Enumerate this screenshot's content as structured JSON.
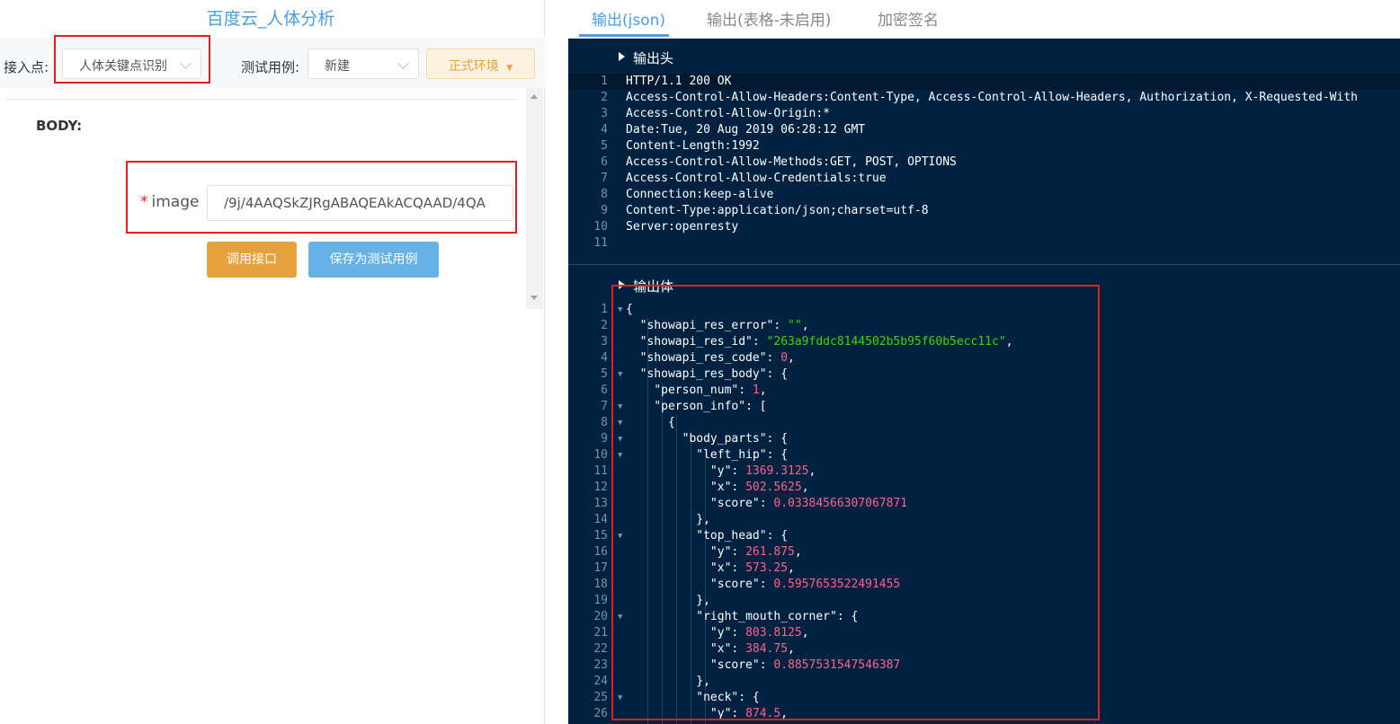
{
  "left": {
    "title": "百度云_人体分析",
    "access_point_label": "接入点:",
    "access_point_value": "人体关键点识别",
    "test_case_label": "测试用例:",
    "test_case_value": "新建",
    "env_button": "正式环境",
    "env_caret": "▼",
    "body_label": "BODY:",
    "image_required_mark": "*",
    "image_label": "image",
    "image_value": "/9j/4AAQSkZJRgABAQEAkACQAAD/4QA",
    "call_button": "调用接口",
    "save_button": "保存为测试用例"
  },
  "tabs": [
    "输出(json)",
    "输出(表格-未启用)",
    "加密签名"
  ],
  "output_header": {
    "title": "输出头",
    "lines": [
      "HTTP/1.1 200 OK",
      "Access-Control-Allow-Headers:Content-Type, Access-Control-Allow-Headers, Authorization, X-Requested-With",
      "Access-Control-Allow-Origin:*",
      "Date:Tue, 20 Aug 2019 06:28:12 GMT",
      "Content-Length:1992",
      "Access-Control-Allow-Methods:GET, POST, OPTIONS",
      "Access-Control-Allow-Credentials:true",
      "Connection:keep-alive",
      "Content-Type:application/json;charset=utf-8",
      "Server:openresty",
      ""
    ]
  },
  "output_body": {
    "title": "输出体",
    "lines": [
      {
        "n": "1",
        "fold": true,
        "t": [
          [
            "p",
            "{"
          ]
        ]
      },
      {
        "n": "2",
        "t": [
          [
            "p",
            "  "
          ],
          [
            "k",
            "\"showapi_res_error\""
          ],
          [
            "p",
            ": "
          ],
          [
            "s",
            "\"\""
          ],
          [
            "p",
            ","
          ]
        ]
      },
      {
        "n": "3",
        "t": [
          [
            "p",
            "  "
          ],
          [
            "k",
            "\"showapi_res_id\""
          ],
          [
            "p",
            ": "
          ],
          [
            "s",
            "\"263a9fddc8144502b5b95f60b5ecc11c\""
          ],
          [
            "p",
            ","
          ]
        ]
      },
      {
        "n": "4",
        "t": [
          [
            "p",
            "  "
          ],
          [
            "k",
            "\"showapi_res_code\""
          ],
          [
            "p",
            ": "
          ],
          [
            "n",
            "0"
          ],
          [
            "p",
            ","
          ]
        ]
      },
      {
        "n": "5",
        "fold": true,
        "t": [
          [
            "p",
            "  "
          ],
          [
            "k",
            "\"showapi_res_body\""
          ],
          [
            "p",
            ": {"
          ]
        ]
      },
      {
        "n": "6",
        "t": [
          [
            "p",
            "    "
          ],
          [
            "k",
            "\"person_num\""
          ],
          [
            "p",
            ": "
          ],
          [
            "n",
            "1"
          ],
          [
            "p",
            ","
          ]
        ]
      },
      {
        "n": "7",
        "fold": true,
        "t": [
          [
            "p",
            "    "
          ],
          [
            "k",
            "\"person_info\""
          ],
          [
            "p",
            ": ["
          ]
        ]
      },
      {
        "n": "8",
        "fold": true,
        "t": [
          [
            "p",
            "      {"
          ]
        ]
      },
      {
        "n": "9",
        "fold": true,
        "t": [
          [
            "p",
            "        "
          ],
          [
            "k",
            "\"body_parts\""
          ],
          [
            "p",
            ": {"
          ]
        ]
      },
      {
        "n": "10",
        "fold": true,
        "t": [
          [
            "p",
            "          "
          ],
          [
            "k",
            "\"left_hip\""
          ],
          [
            "p",
            ": {"
          ]
        ]
      },
      {
        "n": "11",
        "t": [
          [
            "p",
            "            "
          ],
          [
            "k",
            "\"y\""
          ],
          [
            "p",
            ": "
          ],
          [
            "n",
            "1369.3125"
          ],
          [
            "p",
            ","
          ]
        ]
      },
      {
        "n": "12",
        "t": [
          [
            "p",
            "            "
          ],
          [
            "k",
            "\"x\""
          ],
          [
            "p",
            ": "
          ],
          [
            "n",
            "502.5625"
          ],
          [
            "p",
            ","
          ]
        ]
      },
      {
        "n": "13",
        "t": [
          [
            "p",
            "            "
          ],
          [
            "k",
            "\"score\""
          ],
          [
            "p",
            ": "
          ],
          [
            "n",
            "0.03384566307067871"
          ]
        ]
      },
      {
        "n": "14",
        "t": [
          [
            "p",
            "          },"
          ]
        ]
      },
      {
        "n": "15",
        "fold": true,
        "t": [
          [
            "p",
            "          "
          ],
          [
            "k",
            "\"top_head\""
          ],
          [
            "p",
            ": {"
          ]
        ]
      },
      {
        "n": "16",
        "t": [
          [
            "p",
            "            "
          ],
          [
            "k",
            "\"y\""
          ],
          [
            "p",
            ": "
          ],
          [
            "n",
            "261.875"
          ],
          [
            "p",
            ","
          ]
        ]
      },
      {
        "n": "17",
        "t": [
          [
            "p",
            "            "
          ],
          [
            "k",
            "\"x\""
          ],
          [
            "p",
            ": "
          ],
          [
            "n",
            "573.25"
          ],
          [
            "p",
            ","
          ]
        ]
      },
      {
        "n": "18",
        "t": [
          [
            "p",
            "            "
          ],
          [
            "k",
            "\"score\""
          ],
          [
            "p",
            ": "
          ],
          [
            "n",
            "0.5957653522491455"
          ]
        ]
      },
      {
        "n": "19",
        "t": [
          [
            "p",
            "          },"
          ]
        ]
      },
      {
        "n": "20",
        "fold": true,
        "t": [
          [
            "p",
            "          "
          ],
          [
            "k",
            "\"right_mouth_corner\""
          ],
          [
            "p",
            ": {"
          ]
        ]
      },
      {
        "n": "21",
        "t": [
          [
            "p",
            "            "
          ],
          [
            "k",
            "\"y\""
          ],
          [
            "p",
            ": "
          ],
          [
            "n",
            "803.8125"
          ],
          [
            "p",
            ","
          ]
        ]
      },
      {
        "n": "22",
        "t": [
          [
            "p",
            "            "
          ],
          [
            "k",
            "\"x\""
          ],
          [
            "p",
            ": "
          ],
          [
            "n",
            "384.75"
          ],
          [
            "p",
            ","
          ]
        ]
      },
      {
        "n": "23",
        "t": [
          [
            "p",
            "            "
          ],
          [
            "k",
            "\"score\""
          ],
          [
            "p",
            ": "
          ],
          [
            "n",
            "0.8857531547546387"
          ]
        ]
      },
      {
        "n": "24",
        "t": [
          [
            "p",
            "          },"
          ]
        ]
      },
      {
        "n": "25",
        "fold": true,
        "t": [
          [
            "p",
            "          "
          ],
          [
            "k",
            "\"neck\""
          ],
          [
            "p",
            ": {"
          ]
        ]
      },
      {
        "n": "26",
        "t": [
          [
            "p",
            "            "
          ],
          [
            "k",
            "\"y\""
          ],
          [
            "p",
            ": "
          ],
          [
            "n",
            "874.5"
          ],
          [
            "p",
            ","
          ]
        ]
      }
    ]
  },
  "colors": {
    "accent": "#4a9ee0",
    "editor_bg": "#002240",
    "string": "#3ad900",
    "number": "#ff628c",
    "highlight_box": "#e02020",
    "call_button": "#e6a23c",
    "save_button": "#66b1e6"
  }
}
